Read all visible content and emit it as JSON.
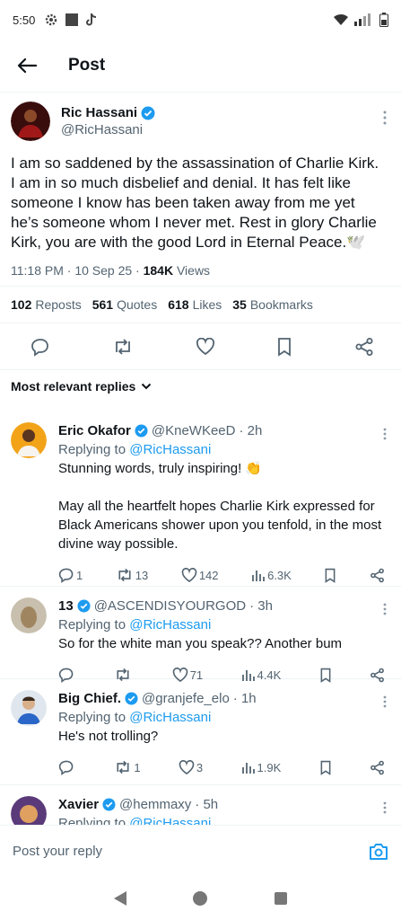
{
  "status_bar": {
    "time": "5:50"
  },
  "header": {
    "title": "Post"
  },
  "post": {
    "author": {
      "name": "Ric Hassani",
      "handle": "@RicHassani"
    },
    "text": "I am so saddened by the assassination of Charlie Kirk. I am in so much disbelief and denial. It has felt like someone I know has been taken away from me yet he’s someone whom I never met. Rest in glory Charlie Kirk, you are with the good Lord in Eternal Peace.🕊️",
    "time": "11:18 PM · 10 Sep 25 · ",
    "views_count": "184K",
    "views_label": " Views",
    "stats": {
      "reposts_count": "102",
      "reposts_label": "Reposts",
      "quotes_count": "561",
      "quotes_label": "Quotes",
      "likes_count": "618",
      "likes_label": "Likes",
      "bookmarks_count": "35",
      "bookmarks_label": "Bookmarks"
    }
  },
  "sort_label": "Most relevant replies",
  "replies": [
    {
      "name": "Eric Okafor",
      "handle": "@KneWKeeD",
      "time": "· 2h",
      "replying_prefix": "Replying to ",
      "replying_to": "@RicHassani",
      "text1": "Stunning words, truly inspiring! 👏",
      "text2": "May all the heartfelt hopes Charlie Kirk expressed for Black Americans shower upon you tenfold, in the most divine way possible.",
      "replies": "1",
      "reposts": "13",
      "likes": "142",
      "views": "6.3K"
    },
    {
      "name": "13",
      "handle": "@ASCENDISYOURGOD",
      "time": "· 3h",
      "replying_prefix": "Replying to ",
      "replying_to": "@RicHassani",
      "text1": "So for the white man you speak?? Another bum",
      "replies": "",
      "reposts": "",
      "likes": "71",
      "views": "4.4K"
    },
    {
      "name": "Big Chief.",
      "handle": "@granjefe_elo",
      "time": "· 1h",
      "replying_prefix": "Replying to ",
      "replying_to": "@RicHassani",
      "text1": "He's not trolling?",
      "replies": "",
      "reposts": "1",
      "likes": "3",
      "views": "1.9K"
    },
    {
      "name": "Xavier",
      "handle": "@hemmaxy",
      "time": "· 5h",
      "replying_prefix": "Replying to ",
      "replying_to": "@RicHassani"
    }
  ],
  "compose": {
    "placeholder": "Post your reply"
  },
  "colors": {
    "accent": "#1d9bf0",
    "text": "#0f1419",
    "secondary": "#536471"
  }
}
